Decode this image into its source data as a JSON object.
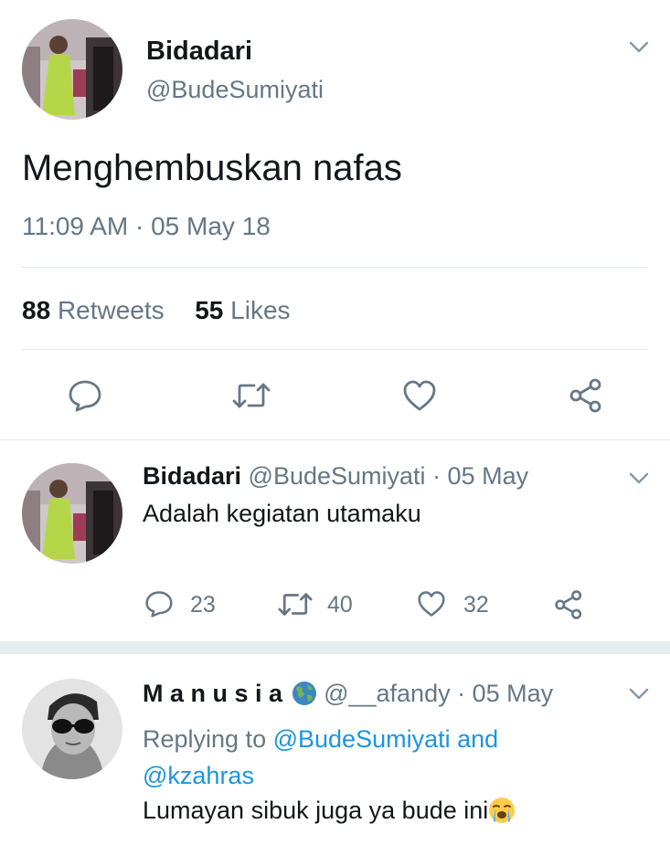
{
  "main_tweet": {
    "display_name": "Bidadari",
    "handle": "@BudeSumiyati",
    "text": "Menghembuskan nafas",
    "timestamp": "11:09 AM · 05 May 18",
    "retweets_count": "88",
    "retweets_label": "Retweets",
    "likes_count": "55",
    "likes_label": "Likes"
  },
  "reply1": {
    "display_name": "Bidadari",
    "handle": "@BudeSumiyati",
    "date": "· 05 May",
    "text": "Adalah kegiatan utamaku",
    "reply_count": "23",
    "retweet_count": "40",
    "like_count": "32"
  },
  "reply2": {
    "display_name": "M a n u s i a",
    "handle": "@__afandy",
    "date": "· 05 May",
    "replying_to_label": "Replying to",
    "replying_to_users": "@BudeSumiyati and",
    "replying_to_users_2": "@kzahras",
    "text": "Lumayan sibuk juga ya bude ini",
    "emoji": "😭"
  },
  "colors": {
    "accent": "#1b95e0",
    "muted": "#657786",
    "icon": "#657786",
    "divider": "#e1e8ed"
  },
  "icons": [
    "chevron-down-icon",
    "reply-icon",
    "retweet-icon",
    "heart-icon",
    "share-icon",
    "globe-emoji"
  ]
}
